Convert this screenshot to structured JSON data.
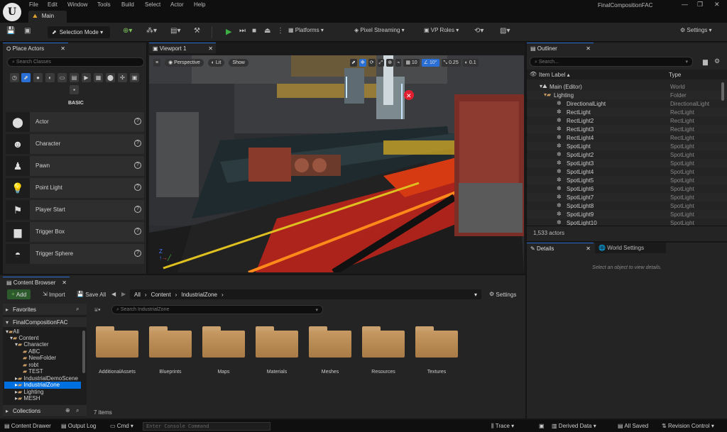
{
  "titlebar": {
    "menu": [
      "File",
      "Edit",
      "Window",
      "Tools",
      "Build",
      "Select",
      "Actor",
      "Help"
    ],
    "main_tab": "Main",
    "project_name": "FinalCompositionFAC"
  },
  "toolbar": {
    "selection_mode": "Selection Mode",
    "platforms": "Platforms",
    "pixel_streaming": "Pixel Streaming",
    "vp_roles": "VP Roles",
    "settings": "Settings"
  },
  "place_actors": {
    "tab": "Place Actors",
    "search_placeholder": "Search Classes",
    "category": "BASIC",
    "items": [
      "Actor",
      "Character",
      "Pawn",
      "Point Light",
      "Player Start",
      "Trigger Box",
      "Trigger Sphere"
    ]
  },
  "viewport": {
    "tab": "Viewport 1",
    "perspective": "Perspective",
    "lit": "Lit",
    "show": "Show",
    "grid": "10",
    "angle": "10°",
    "scale": "0.25",
    "camera_speed": "0.1"
  },
  "outliner": {
    "tab": "Outliner",
    "search_placeholder": "Search...",
    "col_label": "Item Label",
    "col_type": "Type",
    "rows": [
      {
        "name": "Main (Editor)",
        "type": "World"
      },
      {
        "name": "Lighting",
        "type": "Folder"
      },
      {
        "name": "DirectionalLight",
        "type": "DirectionalLight"
      },
      {
        "name": "RectLight",
        "type": "RectLight"
      },
      {
        "name": "RectLight2",
        "type": "RectLight"
      },
      {
        "name": "RectLight3",
        "type": "RectLight"
      },
      {
        "name": "RectLight4",
        "type": "RectLight"
      },
      {
        "name": "SpotLight",
        "type": "SpotLight"
      },
      {
        "name": "SpotLight2",
        "type": "SpotLight"
      },
      {
        "name": "SpotLight3",
        "type": "SpotLight"
      },
      {
        "name": "SpotLight4",
        "type": "SpotLight"
      },
      {
        "name": "SpotLight5",
        "type": "SpotLight"
      },
      {
        "name": "SpotLight6",
        "type": "SpotLight"
      },
      {
        "name": "SpotLight7",
        "type": "SpotLight"
      },
      {
        "name": "SpotLight8",
        "type": "SpotLight"
      },
      {
        "name": "SpotLight9",
        "type": "SpotLight"
      },
      {
        "name": "SpotLight10",
        "type": "SpotLight"
      }
    ],
    "actor_count": "1,533 actors"
  },
  "details": {
    "tab_details": "Details",
    "tab_world": "World Settings",
    "empty_message": "Select an object to view details."
  },
  "content_browser": {
    "tab": "Content Browser",
    "add": "Add",
    "import": "Import",
    "save_all": "Save All",
    "path": [
      "All",
      "Content",
      "IndustrialZone"
    ],
    "settings": "Settings",
    "search_placeholder": "Search IndustrialZone",
    "favorites": "Favorites",
    "project": "FinalCompositionFAC",
    "tree": [
      "All",
      "Content",
      "Character",
      "ABC",
      "NewFolder",
      "robt",
      "TEST",
      "IndustrialDemoScene",
      "IndustrialZone",
      "Lighting",
      "MESH"
    ],
    "collections": "Collections",
    "folders": [
      "AdditionalAssets",
      "Blueprints",
      "Maps",
      "Materials",
      "Meshes",
      "Resources",
      "Textures"
    ],
    "item_count": "7 items"
  },
  "statusbar": {
    "content_drawer": "Content Drawer",
    "output_log": "Output Log",
    "cmd": "Cmd",
    "console_placeholder": "Enter Console Command",
    "trace": "Trace",
    "derived_data": "Derived Data",
    "all_saved": "All Saved",
    "revision_control": "Revision Control"
  },
  "colors": {
    "accent": "#2a6fd6",
    "selection": "#0070e0",
    "play": "#3cb043",
    "folder": "#c79a63"
  }
}
